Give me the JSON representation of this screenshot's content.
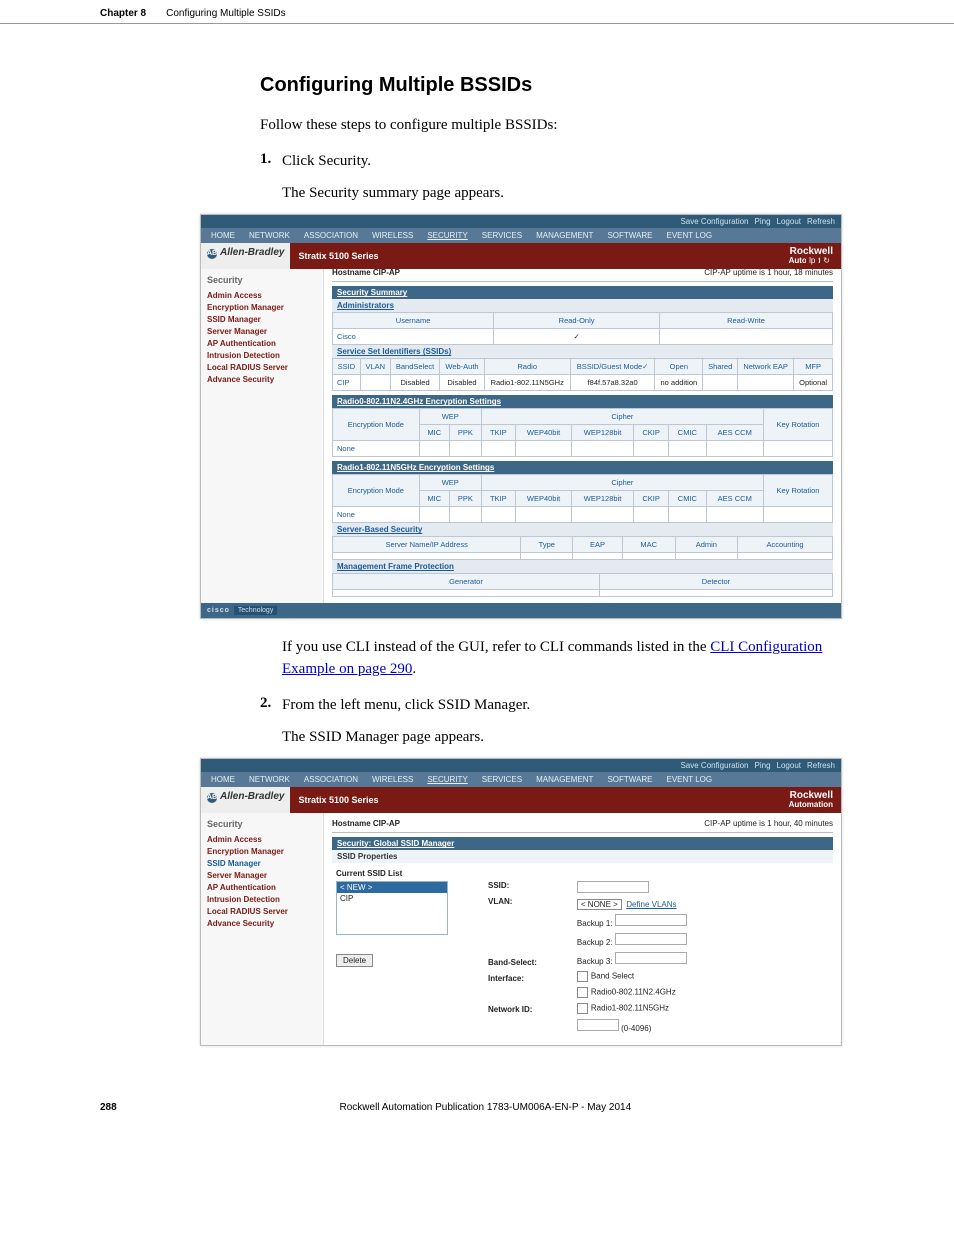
{
  "header": {
    "chapter": "Chapter 8",
    "title": "Configuring Multiple SSIDs"
  },
  "section": {
    "heading": "Configuring Multiple BSSIDs",
    "intro": "Follow these steps to configure multiple BSSIDs:",
    "step1_num": "1.",
    "step1_text": "Click Security.",
    "step1_follow": "The Security summary page appears.",
    "step1_note_a": "If you use CLI instead of the GUI, refer to CLI commands listed in the ",
    "step1_note_link": "CLI Configuration Example on page 290",
    "step1_note_b": ".",
    "step2_num": "2.",
    "step2_text": "From the left menu, click SSID Manager.",
    "step2_follow": "The SSID Manager page appears."
  },
  "footer": {
    "page": "288",
    "pub": "Rockwell Automation Publication 1783-UM006A-EN-P - May 2014"
  },
  "shot_common": {
    "top_links": [
      "Save Configuration",
      "Ping",
      "Logout",
      "Refresh"
    ],
    "nav": [
      "HOME",
      "NETWORK",
      "ASSOCIATION",
      "WIRELESS",
      "SECURITY",
      "SERVICES",
      "MANAGEMENT",
      "SOFTWARE",
      "EVENT LOG"
    ],
    "series": "Stratix 5100 Series",
    "ab": "Allen-Bradley",
    "ra1": "Rockwell",
    "ra2": "Automation",
    "hostname_lbl": "Hostname CIP-AP",
    "left_cat": "Security",
    "left_items": [
      "Admin Access",
      "Encryption Manager",
      "SSID Manager",
      "Server Manager",
      "AP Authentication",
      "Intrusion Detection",
      "Local RADIUS Server",
      "Advance Security"
    ],
    "cisco": "cisco",
    "tech": "Technology"
  },
  "shot1": {
    "uptime": "CIP-AP uptime is 1 hour, 18 minutes",
    "sec_summary": "Security Summary",
    "administrators": "Administrators",
    "admin_cols": {
      "user": "Username",
      "ro": "Read-Only",
      "rw": "Read-Write"
    },
    "admin_row": {
      "user": "Cisco",
      "ro": "✓",
      "rw": ""
    },
    "ssids_hdr": "Service Set Identifiers (SSIDs)",
    "ssid_cols": [
      "SSID",
      "VLAN",
      "BandSelect",
      "Web-Auth",
      "Radio",
      "BSSID/Guest Mode✓",
      "Open",
      "Shared",
      "Network EAP",
      "MFP"
    ],
    "ssid_row": [
      "CIP",
      "",
      "Disabled",
      "Disabled",
      "Radio1-802.11N5GHz",
      "f84f.57a8.32a0",
      "no addition",
      "",
      "",
      "Optional"
    ],
    "enc0_hdr": "Radio0-802.11N2.4GHz Encryption Settings",
    "enc1_hdr": "Radio1-802.11N5GHz Encryption Settings",
    "enc_cols_top": [
      "Encryption Mode",
      "WEP",
      "Cipher",
      "Key Rotation"
    ],
    "enc_cols_sub": [
      "MIC",
      "PPK",
      "TKIP",
      "WEP40bit",
      "WEP128bit",
      "CKIP",
      "CMIC",
      "AES CCM"
    ],
    "enc_none": "None",
    "srv_hdr": "Server-Based Security",
    "srv_cols": [
      "Server Name/IP Address",
      "Type",
      "EAP",
      "MAC",
      "Admin",
      "Accounting"
    ],
    "mfp_hdr": "Management Frame Protection",
    "mfp_cols": [
      "Generator",
      "Detector"
    ]
  },
  "shot2": {
    "uptime": "CIP-AP uptime is 1 hour, 40 minutes",
    "bar": "Security: Global SSID Manager",
    "props": "SSID Properties",
    "list_lbl": "Current SSID List",
    "list_new": "< NEW >",
    "list_cip": "CIP",
    "ssid_lbl": "SSID:",
    "vlan_lbl": "VLAN:",
    "vlan_val": "< NONE >",
    "vlan_define": "Define VLANs",
    "backup1": "Backup 1:",
    "backup2": "Backup 2:",
    "backup3": "Backup 3:",
    "bandsel_lbl": "Band-Select:",
    "bandsel_opt": "Band Select",
    "iface_lbl": "Interface:",
    "iface_r0": "Radio0-802.11N2.4GHz",
    "iface_r1": "Radio1-802.11N5GHz",
    "netid_lbl": "Network ID:",
    "netid_range": "(0-4096)",
    "delete": "Delete"
  }
}
